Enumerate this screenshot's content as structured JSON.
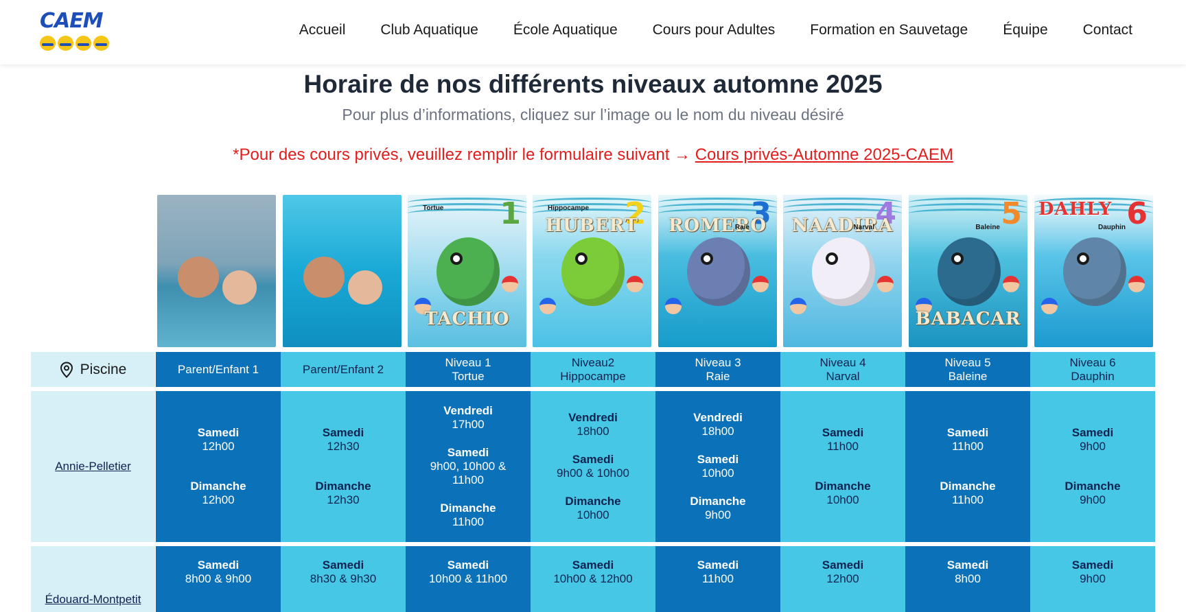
{
  "logo": {
    "text": "CAEM"
  },
  "nav": [
    "Accueil",
    "Club Aquatique",
    "École Aquatique",
    "Cours pour Adultes",
    "Formation en Sauvetage",
    "Équipe",
    "Contact"
  ],
  "page": {
    "title": "Horaire de nos différents niveaux automne 2025",
    "subtitle": "Pour plus d’informations, cliquez sur l’image ou le nom du niveau désiré",
    "private_text": "*Pour des cours privés, veuillez remplir le formulaire suivant → ",
    "private_link": "Cours privés-Automne 2025-CAEM"
  },
  "images": [
    {
      "name": "",
      "number": "",
      "kind": "photo"
    },
    {
      "name": "",
      "number": "",
      "kind": "photo"
    },
    {
      "name": "TACHIO",
      "number": "1",
      "small": "Tortue",
      "kind": "illustration"
    },
    {
      "name": "HUBERT",
      "number": "2",
      "small": "Hippocampe",
      "kind": "illustration"
    },
    {
      "name": "ROMERO",
      "number": "3",
      "small": "Raie",
      "kind": "illustration"
    },
    {
      "name": "NAADIRA",
      "number": "4",
      "small": "Narval",
      "kind": "illustration"
    },
    {
      "name": "BABACAR",
      "number": "5",
      "small": "Baleine",
      "kind": "illustration"
    },
    {
      "name": "DAHLY",
      "number": "6",
      "small": "Dauphin",
      "kind": "illustration"
    }
  ],
  "table": {
    "pool_header": "Piscine",
    "levels": [
      {
        "line1": "Parent/Enfant 1",
        "line2": ""
      },
      {
        "line1": "Parent/Enfant 2",
        "line2": ""
      },
      {
        "line1": "Niveau 1",
        "line2": "Tortue"
      },
      {
        "line1": "Niveau2",
        "line2": "Hippocampe"
      },
      {
        "line1": "Niveau 3",
        "line2": "Raie"
      },
      {
        "line1": "Niveau 4",
        "line2": "Narval"
      },
      {
        "line1": "Niveau 5",
        "line2": "Baleine"
      },
      {
        "line1": "Niveau 6",
        "line2": "Dauphin"
      }
    ],
    "pools": [
      {
        "name": "Annie-Pelletier",
        "cells": [
          [
            {
              "day": "Samedi",
              "time": "12h00"
            },
            {
              "day": "Dimanche",
              "time": "12h00"
            }
          ],
          [
            {
              "day": "Samedi",
              "time": "12h30"
            },
            {
              "day": "Dimanche",
              "time": "12h30"
            }
          ],
          [
            {
              "day": "Vendredi",
              "time": "17h00"
            },
            {
              "day": "Samedi",
              "time": "9h00, 10h00 &\n11h00"
            },
            {
              "day": "Dimanche",
              "time": "11h00"
            }
          ],
          [
            {
              "day": "Vendredi",
              "time": "18h00"
            },
            {
              "day": "Samedi",
              "time": "9h00 & 10h00"
            },
            {
              "day": "Dimanche",
              "time": "10h00"
            }
          ],
          [
            {
              "day": "Vendredi",
              "time": "18h00"
            },
            {
              "day": "Samedi",
              "time": "10h00"
            },
            {
              "day": "Dimanche",
              "time": "9h00"
            }
          ],
          [
            {
              "day": "Samedi",
              "time": "11h00"
            },
            {
              "day": "Dimanche",
              "time": "10h00"
            }
          ],
          [
            {
              "day": "Samedi",
              "time": "11h00"
            },
            {
              "day": "Dimanche",
              "time": "11h00"
            }
          ],
          [
            {
              "day": "Samedi",
              "time": "9h00"
            },
            {
              "day": "Dimanche",
              "time": "9h00"
            }
          ]
        ]
      },
      {
        "name": "Édouard-Montpetit",
        "cells": [
          [
            {
              "day": "Samedi",
              "time": "8h00 & 9h00"
            }
          ],
          [
            {
              "day": "Samedi",
              "time": "8h30 & 9h30"
            }
          ],
          [
            {
              "day": "Samedi",
              "time": "10h00 & 11h00"
            }
          ],
          [
            {
              "day": "Samedi",
              "time": "10h00 & 12h00"
            }
          ],
          [
            {
              "day": "Samedi",
              "time": "11h00"
            }
          ],
          [
            {
              "day": "Samedi",
              "time": "12h00"
            }
          ],
          [
            {
              "day": "Samedi",
              "time": "8h00"
            }
          ],
          [
            {
              "day": "Samedi",
              "time": "9h00"
            }
          ]
        ]
      }
    ]
  },
  "colors": {
    "dark_cell": "#0b72b9",
    "light_cell": "#47c7e6",
    "pale_cell": "#d7f0f8",
    "red_text": "#e11d1d",
    "brand_blue": "#1e4fb8"
  }
}
